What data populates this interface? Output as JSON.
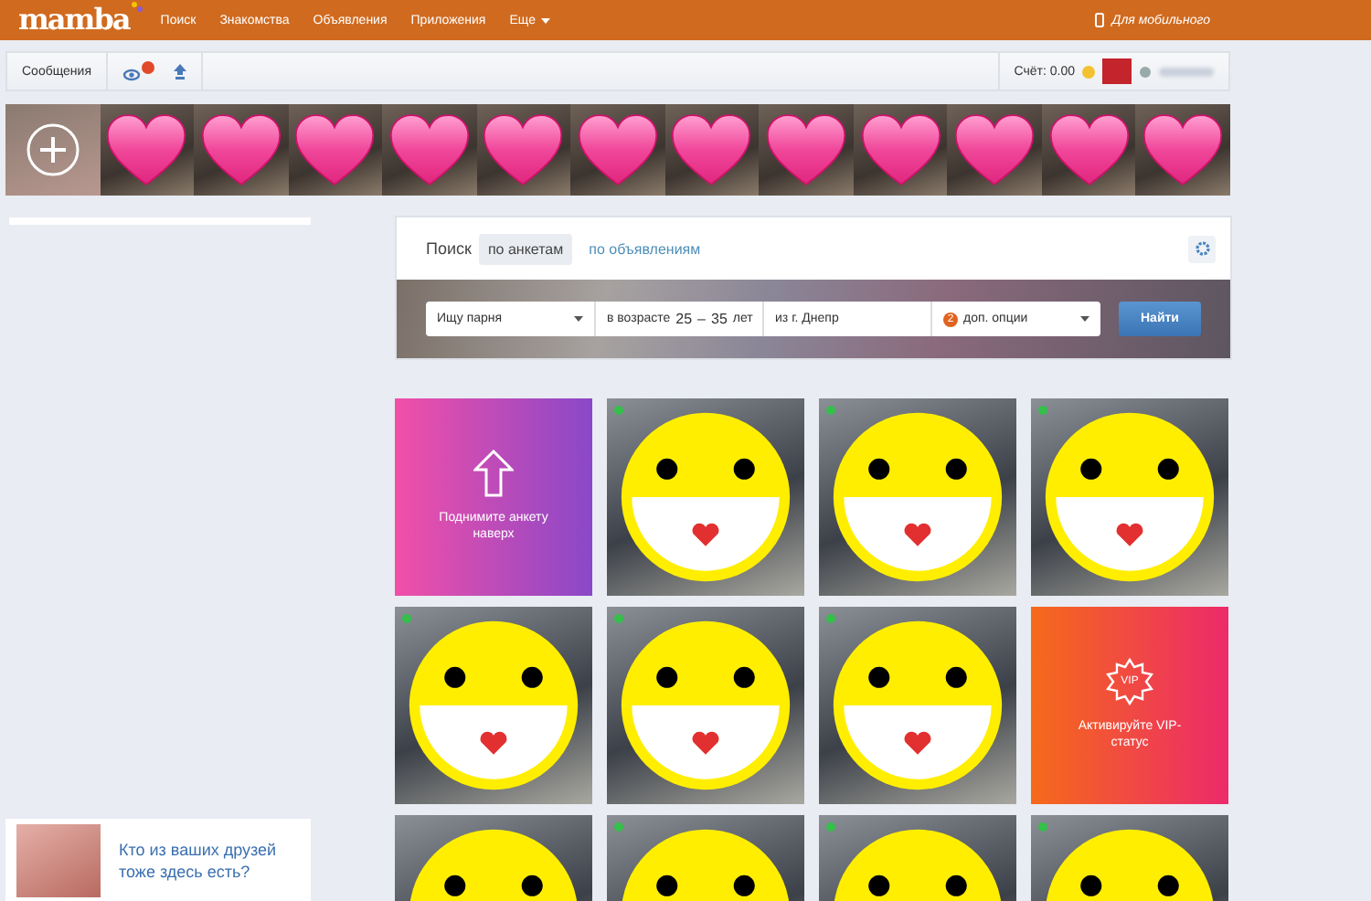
{
  "top_bar": {
    "logo": "mamba",
    "nav": [
      "Поиск",
      "Знакомства",
      "Объявления",
      "Приложения",
      "Еще"
    ],
    "mobile_link": "Для мобильного"
  },
  "toolbar": {
    "messages": "Сообщения",
    "balance": "Счёт: 0.00"
  },
  "photo_strip": [
    {
      "kind": "add"
    },
    {
      "kind": "photo"
    },
    {
      "kind": "photo"
    },
    {
      "kind": "photo"
    },
    {
      "kind": "photo"
    },
    {
      "kind": "photo"
    },
    {
      "kind": "photo"
    },
    {
      "kind": "photo"
    },
    {
      "kind": "photo"
    },
    {
      "kind": "photo"
    },
    {
      "kind": "photo"
    },
    {
      "kind": "photo"
    },
    {
      "kind": "photo"
    }
  ],
  "search": {
    "label": "Поиск",
    "tabs": [
      {
        "label": "по анкетам",
        "selected": true
      },
      {
        "label": "по объявлениям",
        "selected": false
      }
    ],
    "looking_for": "Ищу парня",
    "age_label": "в возрасте",
    "age_from": "25",
    "age_separator": "–",
    "age_to": "35",
    "age_unit": "лет",
    "city": "из г. Днепр",
    "options_count": "2",
    "options": "доп. опции",
    "submit": "Найти"
  },
  "grid": [
    {
      "kind": "promo",
      "text": "Поднимите анкету наверх"
    },
    {
      "kind": "photo",
      "online": true
    },
    {
      "kind": "photo",
      "online": true
    },
    {
      "kind": "photo",
      "online": true
    },
    {
      "kind": "photo",
      "online": true
    },
    {
      "kind": "photo",
      "online": true
    },
    {
      "kind": "photo",
      "online": true
    },
    {
      "kind": "vip",
      "badge": "VIP",
      "text": "Активируйте VIP-статус"
    },
    {
      "kind": "photo",
      "online": false
    },
    {
      "kind": "photo",
      "online": true
    },
    {
      "kind": "photo",
      "online": true
    },
    {
      "kind": "photo",
      "online": true
    }
  ],
  "friend_card": {
    "text": "Кто из ваших друзей тоже здесь есть?"
  }
}
